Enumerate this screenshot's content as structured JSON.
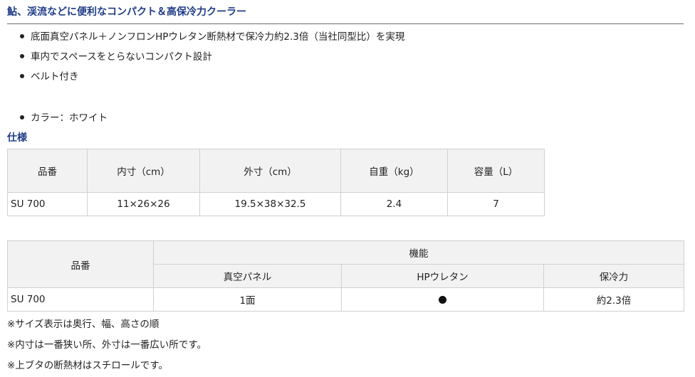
{
  "heading": "鮎、渓流などに便利なコンパクト＆高保冷力クーラー",
  "features": [
    "底面真空パネル＋ノンフロンHPウレタン断熱材で保冷力約2.3倍（当社同型比）を実現",
    "車内でスペースをとらないコンパクト設計",
    "ベルト付き"
  ],
  "color_line": "カラー：ホワイト",
  "spec_title": "仕様",
  "spec_table": {
    "headers": [
      "品番",
      "内寸（cm）",
      "外寸（cm）",
      "自重（kg）",
      "容量（L）"
    ],
    "row": [
      "SU 700",
      "11×26×26",
      "19.5×38×32.5",
      "2.4",
      "7"
    ]
  },
  "feature_table": {
    "model_header": "品番",
    "group_header": "機能",
    "sub_headers": [
      "真空パネル",
      "HPウレタン",
      "保冷力"
    ],
    "row": {
      "model": "SU 700",
      "vacuum_panel": "1面",
      "hp_urethane_icon": "filled-circle",
      "cooling_power": "約2.3倍"
    }
  },
  "notes": [
    "※サイズ表示は奥行、幅、高さの順",
    "※内寸は一番狭い所、外寸は一番広い所です。",
    "※上ブタの断熱材はスチロールです。"
  ]
}
